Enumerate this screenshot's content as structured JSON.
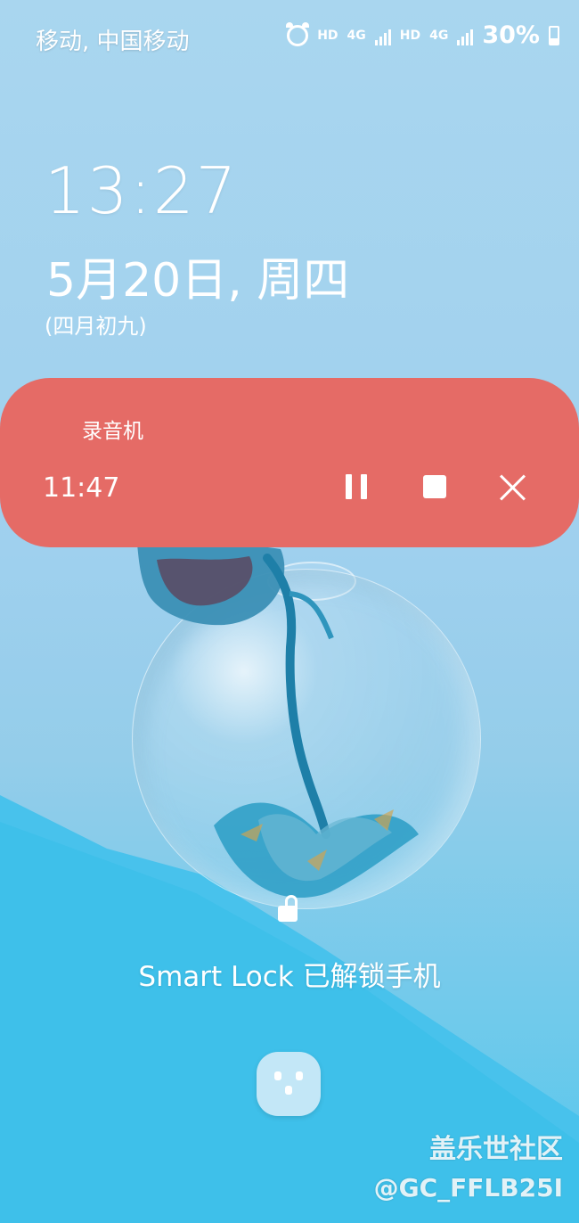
{
  "status_bar": {
    "carrier_text": "移动, 中国移动",
    "hd_1": "HD",
    "network_1": "4G",
    "hd_2": "HD",
    "network_2": "4G",
    "battery_percent": "30%",
    "battery_level": 0.3,
    "icons": [
      "alarm-icon",
      "signal-icon",
      "battery-icon"
    ]
  },
  "lockscreen": {
    "time": "13:27",
    "date": "5月20日, 周四",
    "lunar_date": "(四月初九)",
    "smart_lock_message": "Smart Lock 已解锁手机"
  },
  "recorder_notification": {
    "app_name": "录音机",
    "elapsed_time": "11:47",
    "controls": [
      "pause-icon",
      "stop-icon",
      "close-icon"
    ],
    "accent_color": "#e56b66"
  },
  "watermark": {
    "line_1": "盖乐世社区",
    "line_2": "@GC_FFLB25I"
  }
}
